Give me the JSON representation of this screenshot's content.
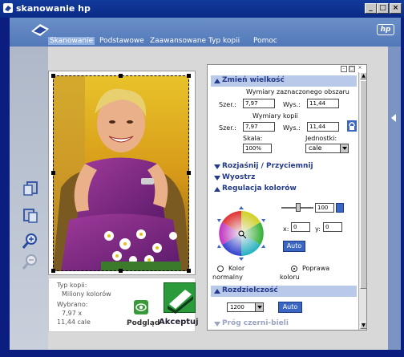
{
  "window": {
    "title": "skanowanie hp"
  },
  "header": {
    "badge": "hp"
  },
  "menu": {
    "items": [
      "Skanowanie",
      "Podstawowe",
      "Zaawansowane",
      "Typ kopii",
      "Pomoc"
    ]
  },
  "info": {
    "copy_type_label": "Typ kopii:",
    "copy_type_value": "Miliony kolorów",
    "selected_label": "Wybrano:",
    "selected_size_line1": "7,97 x",
    "selected_size_line2": "11,44 cale"
  },
  "actions": {
    "preview_label": "Podgląd",
    "accept_label": "Akceptuj"
  },
  "resize": {
    "header": "Zmień wielkość",
    "selected_area_label": "Wymiary zaznaczonego obszaru",
    "width_label": "Szer.:",
    "height_label": "Wys.:",
    "selected_width": "7,97",
    "selected_height": "11,44",
    "copy_dims_label": "Wymiary kopii",
    "copy_width": "7,97",
    "copy_height": "11,44",
    "scale_label": "Skala:",
    "scale_value": "100%",
    "units_label": "Jednostki:",
    "units_value": "cale"
  },
  "sections": {
    "lighten": "Rozjaśnij / Przyciemnij",
    "sharpen": "Wyostrz",
    "color_adjust": "Regulacja kolorów",
    "resolution": "Rozdzielczość",
    "bw_threshold": "Próg czerni-bieli"
  },
  "color": {
    "slider_value": "100",
    "x_label": "x:",
    "x_value": "0",
    "y_label": "y:",
    "y_value": "0",
    "auto_label": "Auto",
    "radio_normal_line1": "Kolor",
    "radio_normal_line2": "normalny",
    "radio_improve_line1": "Poprawa",
    "radio_improve_line2": "koloru",
    "selected_radio": "improve"
  },
  "resolution": {
    "value": "1200",
    "auto_label": "Auto"
  }
}
